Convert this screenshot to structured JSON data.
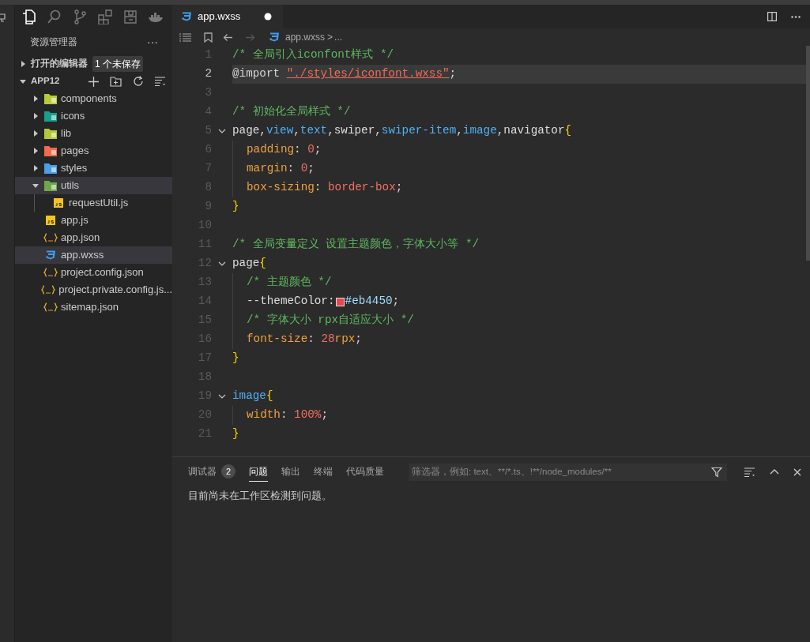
{
  "activity_bar": {
    "items": [
      {
        "kind": "files",
        "selected": true
      },
      {
        "kind": "search",
        "selected": false
      },
      {
        "kind": "branch",
        "selected": false
      },
      {
        "kind": "blocks",
        "selected": false
      },
      {
        "kind": "storage",
        "selected": false
      },
      {
        "kind": "whale",
        "selected": false
      }
    ]
  },
  "explorer": {
    "title": "资源管理器",
    "more": "···",
    "open_editors": {
      "label": "打开的编辑器",
      "badge": "1 个未保存",
      "expanded": false
    },
    "project": {
      "label": "APP12",
      "expanded": true
    },
    "tree": [
      {
        "name": "components",
        "kind": "folder",
        "color": "#b8cc3a",
        "expanded": false,
        "selected": false
      },
      {
        "name": "icons",
        "kind": "folder",
        "color": "#17a08c",
        "expanded": false,
        "selected": false
      },
      {
        "name": "lib",
        "kind": "folder",
        "color": "#b5c83a",
        "expanded": false,
        "selected": false
      },
      {
        "name": "pages",
        "kind": "folder",
        "color": "#f26b4b",
        "expanded": false,
        "selected": false
      },
      {
        "name": "styles",
        "kind": "folder",
        "color": "#4a9fe8",
        "expanded": false,
        "selected": false
      },
      {
        "name": "utils",
        "kind": "folder",
        "color": "#6fa84a",
        "expanded": true,
        "selected": true,
        "children": [
          {
            "name": "requestUtil.js",
            "kind": "js",
            "selected": false
          }
        ]
      },
      {
        "name": "app.js",
        "kind": "js",
        "selected": false
      },
      {
        "name": "app.json",
        "kind": "json",
        "selected": false
      },
      {
        "name": "app.wxss",
        "kind": "wxss",
        "selected": true
      },
      {
        "name": "project.config.json",
        "kind": "json",
        "selected": false
      },
      {
        "name": "project.private.config.js...",
        "kind": "json",
        "selected": false
      },
      {
        "name": "sitemap.json",
        "kind": "json",
        "selected": false
      }
    ]
  },
  "editor": {
    "tabs": [
      {
        "label": "app.wxss",
        "kind": "wxss",
        "modified": true,
        "selected": true
      }
    ],
    "breadcrumb": {
      "file": "app.wxss",
      "separator": ">",
      "rest": "..."
    },
    "lines": [
      {
        "number": "1",
        "current": false,
        "fold": false,
        "indent": false,
        "tokens": [
          {
            "kind": "comment",
            "text": "/* 全局引入iconfont样式 */"
          }
        ]
      },
      {
        "number": "2",
        "current": true,
        "fold": false,
        "indent": false,
        "tokens": [
          {
            "kind": "atrule",
            "text": "@import "
          },
          {
            "kind": "string",
            "text": "\"./styles/iconfont.wxss\""
          },
          {
            "kind": "punct",
            "text": ";"
          }
        ]
      },
      {
        "number": "3",
        "current": false,
        "fold": false,
        "indent": false
      },
      {
        "number": "4",
        "current": false,
        "fold": false,
        "indent": false,
        "tokens": [
          {
            "kind": "comment",
            "text": "/* 初始化全局样式 */"
          }
        ]
      },
      {
        "number": "5",
        "current": false,
        "fold": true,
        "indent": false,
        "tokens": [
          {
            "kind": "selector",
            "text": "page"
          },
          {
            "kind": "punct",
            "text": ","
          },
          {
            "kind": "tag",
            "text": "view"
          },
          {
            "kind": "punct",
            "text": ","
          },
          {
            "kind": "tag",
            "text": "text"
          },
          {
            "kind": "punct",
            "text": ","
          },
          {
            "kind": "selector",
            "text": "swiper"
          },
          {
            "kind": "punct",
            "text": ","
          },
          {
            "kind": "tag",
            "text": "swiper-item"
          },
          {
            "kind": "punct",
            "text": ","
          },
          {
            "kind": "tag",
            "text": "image"
          },
          {
            "kind": "punct",
            "text": ","
          },
          {
            "kind": "selector",
            "text": "navigator"
          },
          {
            "kind": "brace",
            "text": "{"
          }
        ]
      },
      {
        "number": "6",
        "current": false,
        "fold": false,
        "indent": true,
        "tokens": [
          {
            "kind": "prop",
            "text": "padding"
          },
          {
            "kind": "punct",
            "text": ": "
          },
          {
            "kind": "num",
            "text": "0"
          },
          {
            "kind": "punct",
            "text": ";"
          }
        ]
      },
      {
        "number": "7",
        "current": false,
        "fold": false,
        "indent": true,
        "tokens": [
          {
            "kind": "prop",
            "text": "margin"
          },
          {
            "kind": "punct",
            "text": ": "
          },
          {
            "kind": "num",
            "text": "0"
          },
          {
            "kind": "punct",
            "text": ";"
          }
        ]
      },
      {
        "number": "8",
        "current": false,
        "fold": false,
        "indent": true,
        "tokens": [
          {
            "kind": "prop",
            "text": "box-sizing"
          },
          {
            "kind": "punct",
            "text": ": "
          },
          {
            "kind": "num",
            "text": "border-box"
          },
          {
            "kind": "punct",
            "text": ";"
          }
        ]
      },
      {
        "number": "9",
        "current": false,
        "fold": false,
        "indent": false,
        "tokens": [
          {
            "kind": "brace",
            "text": "}"
          }
        ]
      },
      {
        "number": "10",
        "current": false,
        "fold": false,
        "indent": false
      },
      {
        "number": "11",
        "current": false,
        "fold": false,
        "indent": false,
        "tokens": [
          {
            "kind": "comment",
            "text": "/* 全局变量定义 设置主题颜色，字体大小等 */"
          }
        ]
      },
      {
        "number": "12",
        "current": false,
        "fold": true,
        "indent": false,
        "tokens": [
          {
            "kind": "selector",
            "text": "page"
          },
          {
            "kind": "brace",
            "text": "{"
          }
        ]
      },
      {
        "number": "13",
        "current": false,
        "fold": false,
        "indent": true,
        "tokens": [
          {
            "kind": "comment",
            "text": "/* 主题颜色 */"
          }
        ]
      },
      {
        "number": "14",
        "current": false,
        "fold": false,
        "indent": true,
        "tokens": [
          {
            "kind": "selector",
            "text": "--themeColor:"
          },
          {
            "kind": "swatch",
            "color": "#eb4450"
          },
          {
            "kind": "hex",
            "text": "#eb4450"
          },
          {
            "kind": "punct",
            "text": ";"
          }
        ]
      },
      {
        "number": "15",
        "current": false,
        "fold": false,
        "indent": true,
        "tokens": [
          {
            "kind": "comment",
            "text": "/* 字体大小 rpx自适应大小 */"
          }
        ]
      },
      {
        "number": "16",
        "current": false,
        "fold": false,
        "indent": true,
        "tokens": [
          {
            "kind": "prop",
            "text": "font-size"
          },
          {
            "kind": "punct",
            "text": ": "
          },
          {
            "kind": "num",
            "text": "28"
          },
          {
            "kind": "prop",
            "text": "rpx"
          },
          {
            "kind": "punct",
            "text": ";"
          }
        ]
      },
      {
        "number": "17",
        "current": false,
        "fold": false,
        "indent": false,
        "tokens": [
          {
            "kind": "brace",
            "text": "}"
          }
        ]
      },
      {
        "number": "18",
        "current": false,
        "fold": false,
        "indent": false
      },
      {
        "number": "19",
        "current": false,
        "fold": true,
        "indent": false,
        "tokens": [
          {
            "kind": "tag",
            "text": "image"
          },
          {
            "kind": "brace",
            "text": "{"
          }
        ]
      },
      {
        "number": "20",
        "current": false,
        "fold": false,
        "indent": true,
        "tokens": [
          {
            "kind": "prop",
            "text": "width"
          },
          {
            "kind": "punct",
            "text": ": "
          },
          {
            "kind": "num",
            "text": "100%"
          },
          {
            "kind": "punct",
            "text": ";"
          }
        ]
      },
      {
        "number": "21",
        "current": false,
        "fold": false,
        "indent": false,
        "tokens": [
          {
            "kind": "brace",
            "text": "}"
          }
        ]
      }
    ]
  },
  "panel": {
    "tabs": [
      {
        "label": "调试器",
        "badge": "2",
        "selected": false
      },
      {
        "label": "问题",
        "selected": true
      },
      {
        "label": "输出",
        "selected": false
      },
      {
        "label": "终端",
        "selected": false
      },
      {
        "label": "代码质量",
        "selected": false
      }
    ],
    "filter": {
      "placeholder": "筛选器，例如: text、**/*.ts、!**/node_modules/**"
    },
    "message": "目前尚未在工作区检测到问题。"
  }
}
